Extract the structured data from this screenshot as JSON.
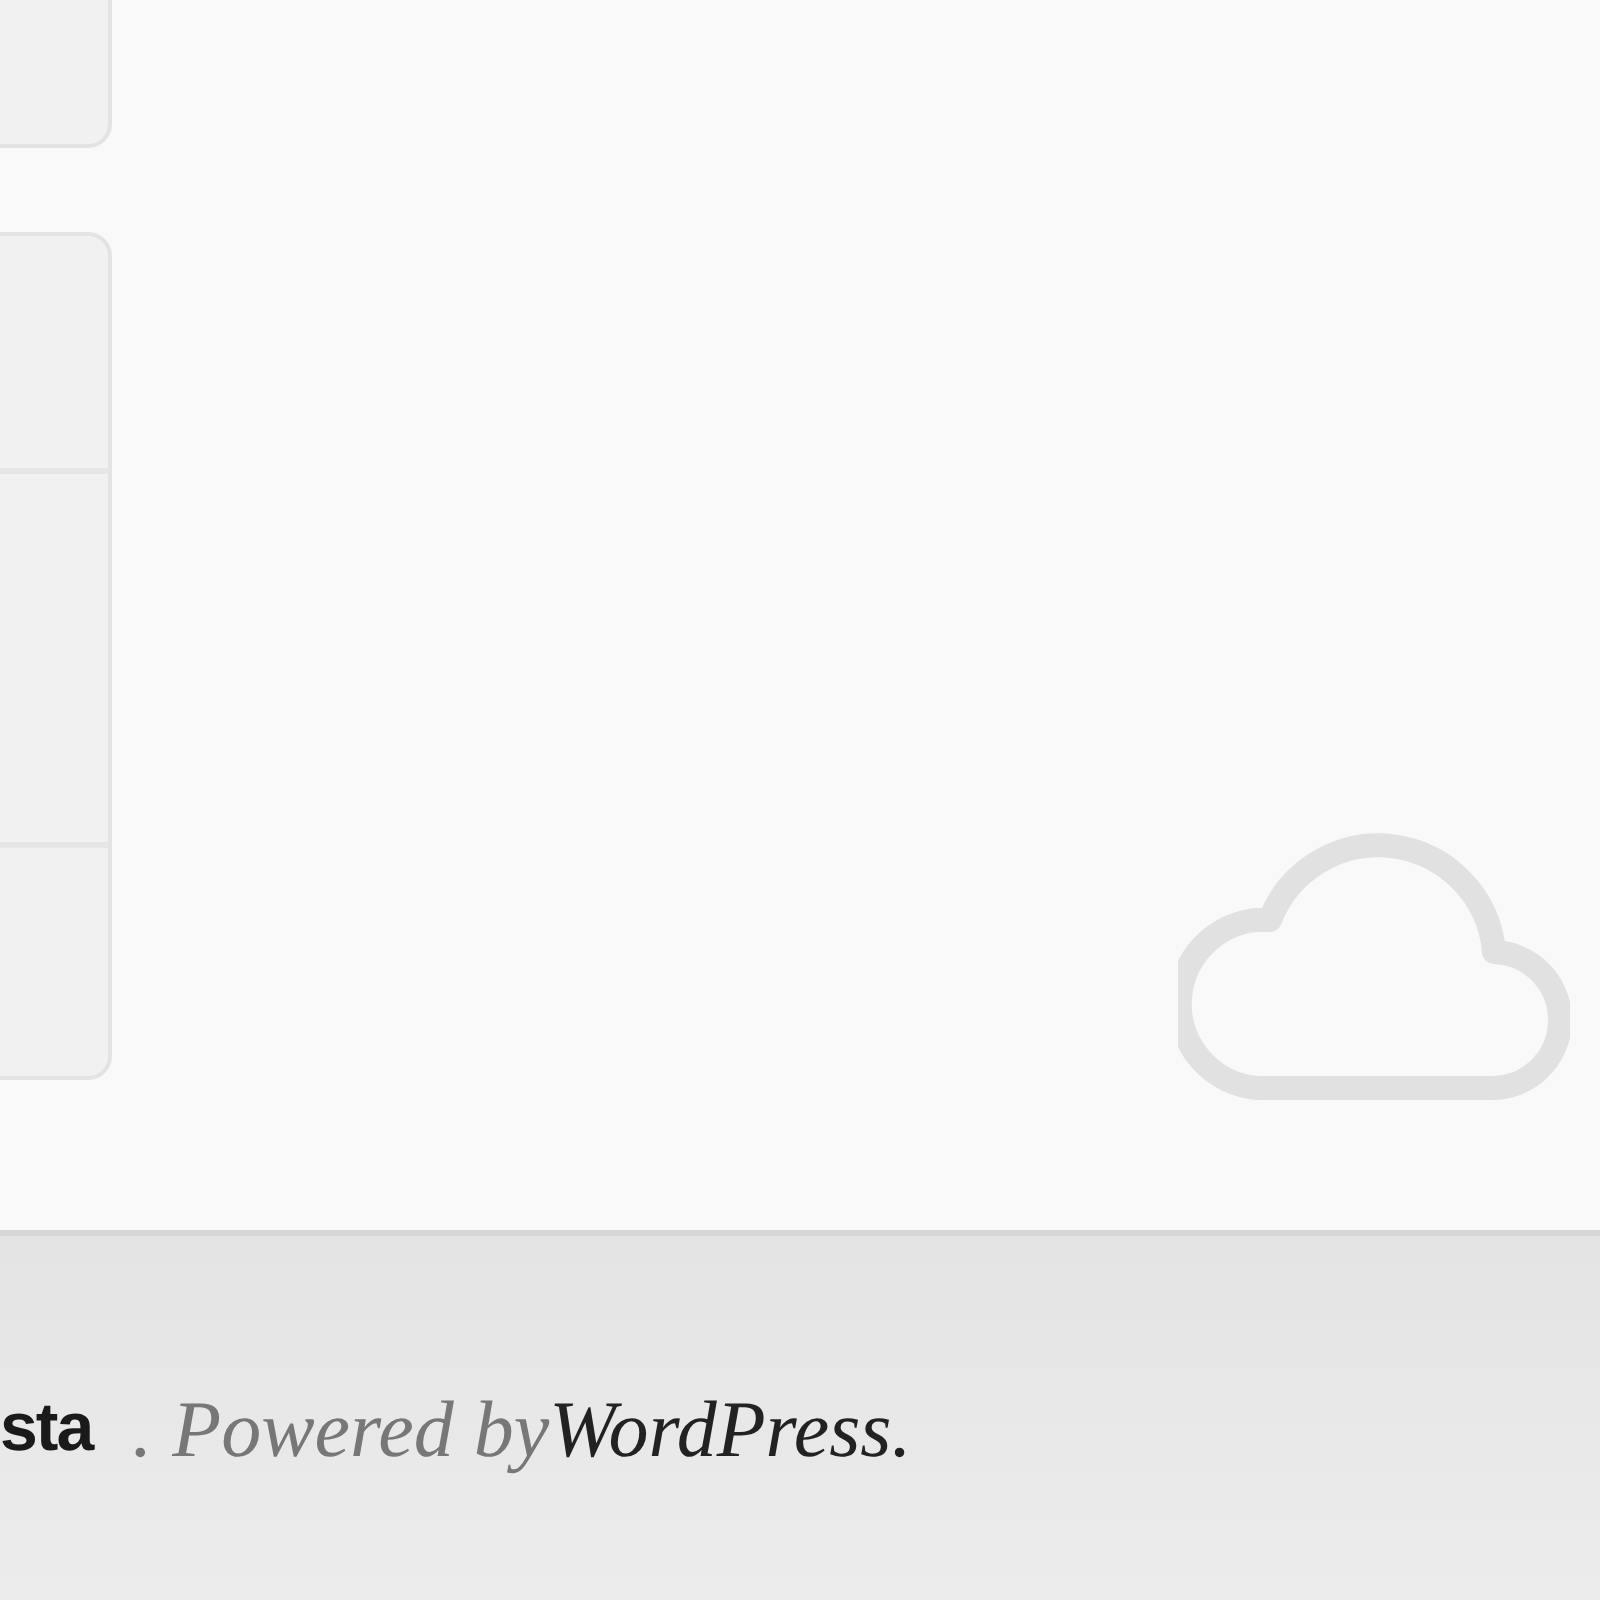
{
  "footer": {
    "site_name": "sta",
    "credit_text": ". Powered by",
    "credit_link": "WordPress",
    "credit_end": "."
  }
}
